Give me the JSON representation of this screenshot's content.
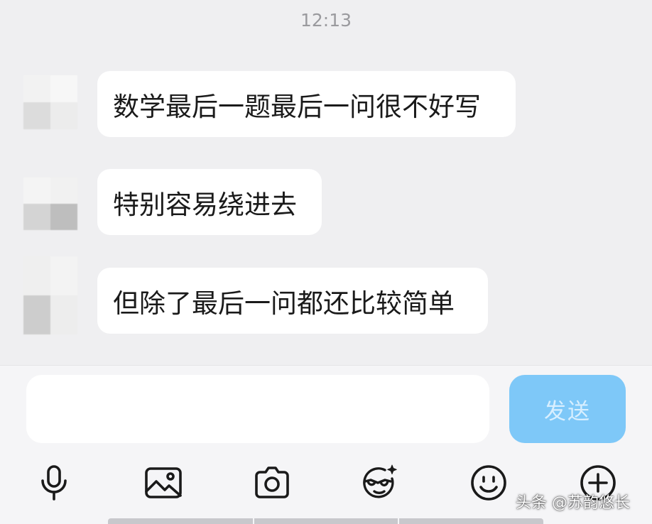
{
  "chat": {
    "timestamp": "12:13",
    "messages": [
      {
        "text": "数学最后一题最后一问很不好写"
      },
      {
        "text": "特别容易绕进去"
      },
      {
        "text": "但除了最后一问都还比较简单"
      }
    ]
  },
  "composer": {
    "input_value": "",
    "input_placeholder": "",
    "send_label": "发送"
  },
  "toolbar": {
    "icons": [
      "microphone-icon",
      "image-icon",
      "camera-icon",
      "sticker-icon",
      "emoji-icon",
      "plus-icon"
    ]
  },
  "watermark": "头条 @苏韵悠长",
  "colors": {
    "background": "#efeff1",
    "bubble": "#ffffff",
    "send_button": "#7ec8f8",
    "text": "#1a1a1a"
  }
}
